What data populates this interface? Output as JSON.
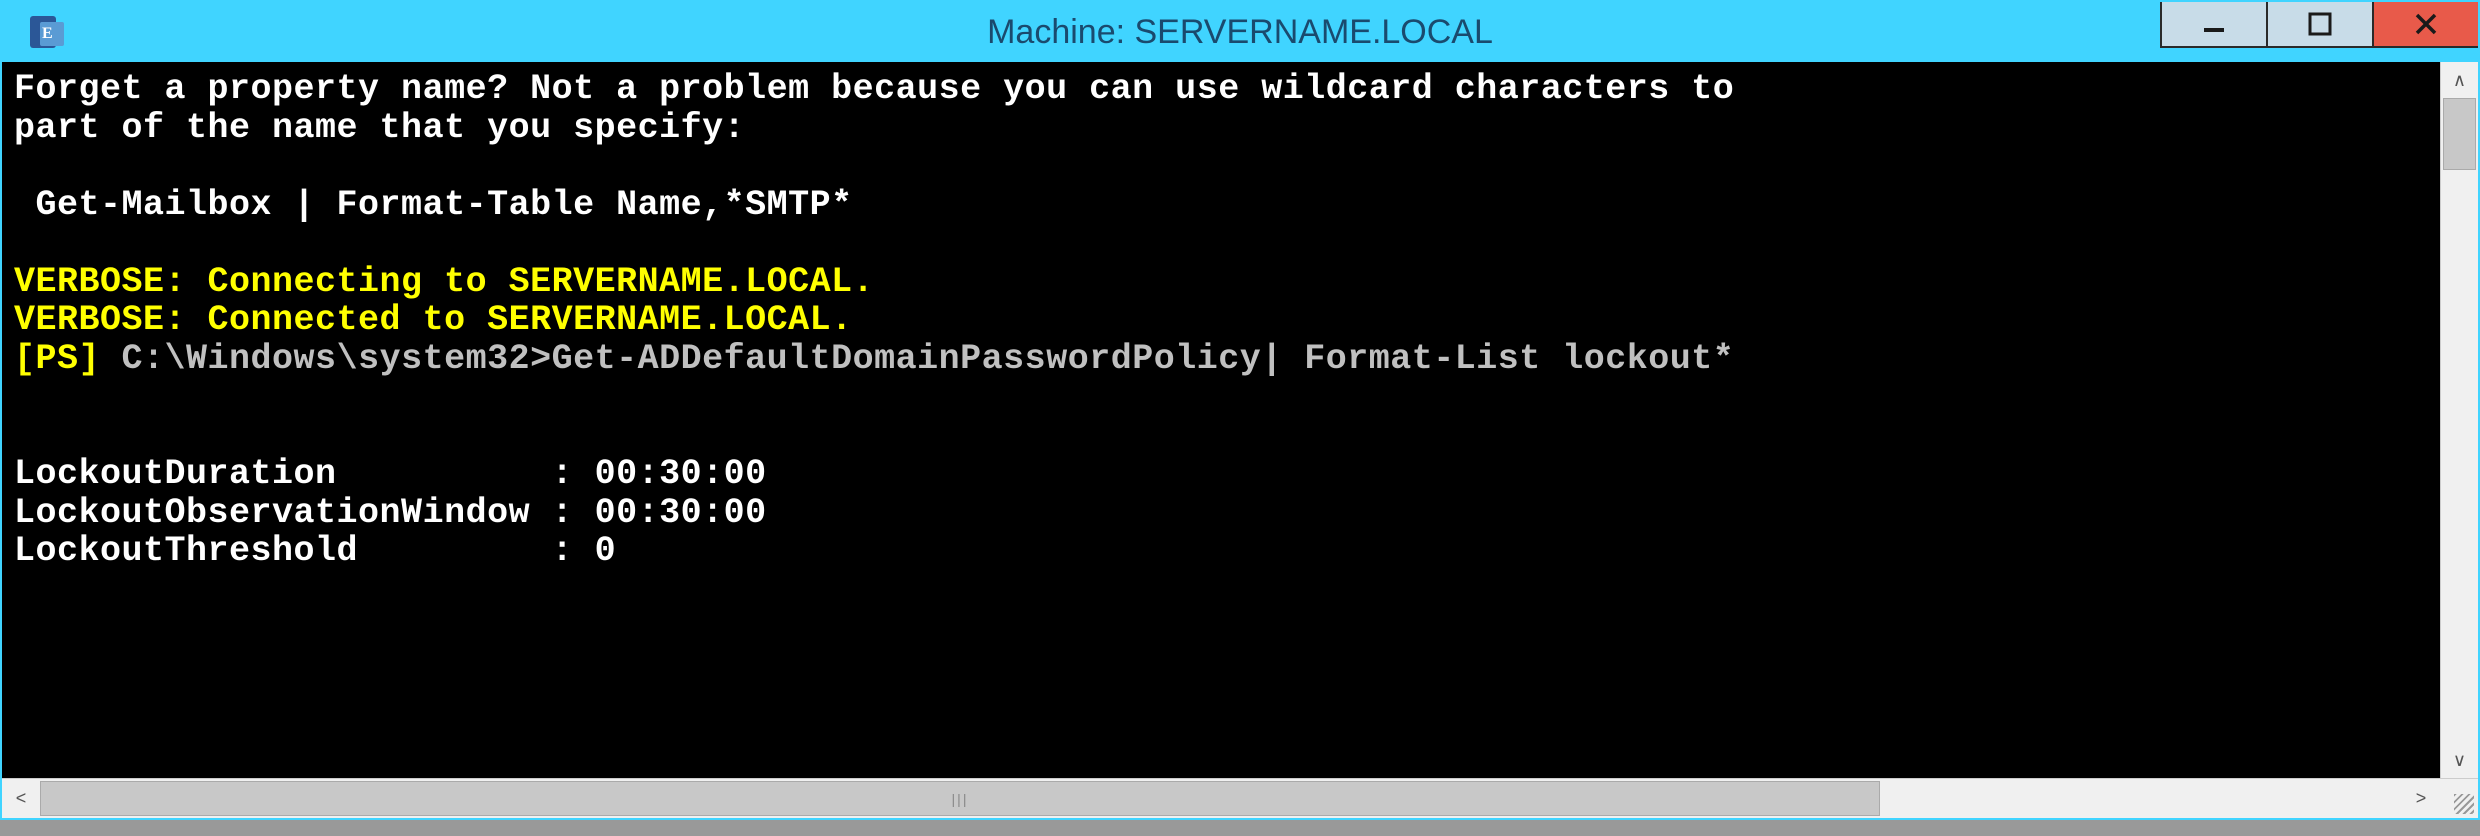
{
  "titlebar": {
    "title": "Machine: SERVERNAME.LOCAL",
    "minimize_glyph": "─",
    "maximize_glyph": "◻",
    "close_glyph": "✕"
  },
  "terminal": {
    "line1": "Forget a property name? Not a problem because you can use wildcard characters to",
    "line2": "part of the name that you specify:",
    "blank": "",
    "example": " Get-Mailbox | Format-Table Name,*SMTP*",
    "verbose1": "VERBOSE: Connecting to SERVERNAME.LOCAL.",
    "verbose2": "VERBOSE: Connected to SERVERNAME.LOCAL.",
    "ps_prefix": "[PS] ",
    "ps_path": "C:\\Windows\\system32>",
    "ps_command": "Get-ADDefaultDomainPasswordPolicy| Format-List lockout*",
    "out1": "LockoutDuration          : 00:30:00",
    "out2": "LockoutObservationWindow : 00:30:00",
    "out3": "LockoutThreshold         : 0"
  },
  "scroll": {
    "up": "∧",
    "down": "∨",
    "left": "<",
    "right": ">",
    "grip": "|||"
  }
}
